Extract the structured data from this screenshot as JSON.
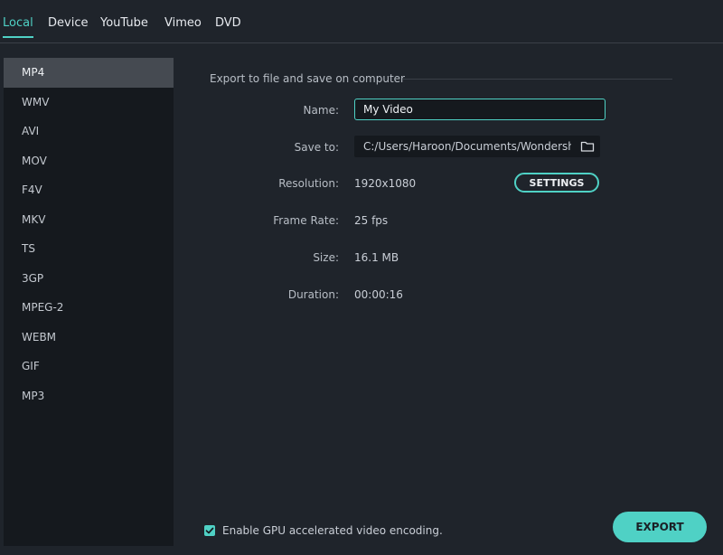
{
  "tabs": [
    {
      "label": "Local",
      "active": true
    },
    {
      "label": "Device",
      "active": false
    },
    {
      "label": "YouTube",
      "active": false
    },
    {
      "label": "Vimeo",
      "active": false
    },
    {
      "label": "DVD",
      "active": false
    }
  ],
  "formats": [
    {
      "label": "MP4",
      "selected": true
    },
    {
      "label": "WMV",
      "selected": false
    },
    {
      "label": "AVI",
      "selected": false
    },
    {
      "label": "MOV",
      "selected": false
    },
    {
      "label": "F4V",
      "selected": false
    },
    {
      "label": "MKV",
      "selected": false
    },
    {
      "label": "TS",
      "selected": false
    },
    {
      "label": "3GP",
      "selected": false
    },
    {
      "label": "MPEG-2",
      "selected": false
    },
    {
      "label": "WEBM",
      "selected": false
    },
    {
      "label": "GIF",
      "selected": false
    },
    {
      "label": "MP3",
      "selected": false
    }
  ],
  "export_panel": {
    "section_title": "Export to file and save on computer",
    "name_label": "Name:",
    "name_value": "My Video",
    "save_to_label": "Save to:",
    "save_to_value": "C:/Users/Haroon/Documents/Wondershare",
    "resolution_label": "Resolution:",
    "resolution_value": "1920x1080",
    "settings_button": "SETTINGS",
    "frame_rate_label": "Frame Rate:",
    "frame_rate_value": "25 fps",
    "size_label": "Size:",
    "size_value": "16.1 MB",
    "duration_label": "Duration:",
    "duration_value": "00:00:16"
  },
  "gpu": {
    "label": "Enable GPU accelerated video encoding.",
    "checked": true
  },
  "export_button": "EXPORT",
  "icons": {
    "folder": "folder-icon",
    "checkbox": "checkmark-icon"
  },
  "colors": {
    "accent": "#4fd1c5",
    "background": "#1f242b",
    "sidebar": "#15191e",
    "selected_item": "#454a51"
  }
}
